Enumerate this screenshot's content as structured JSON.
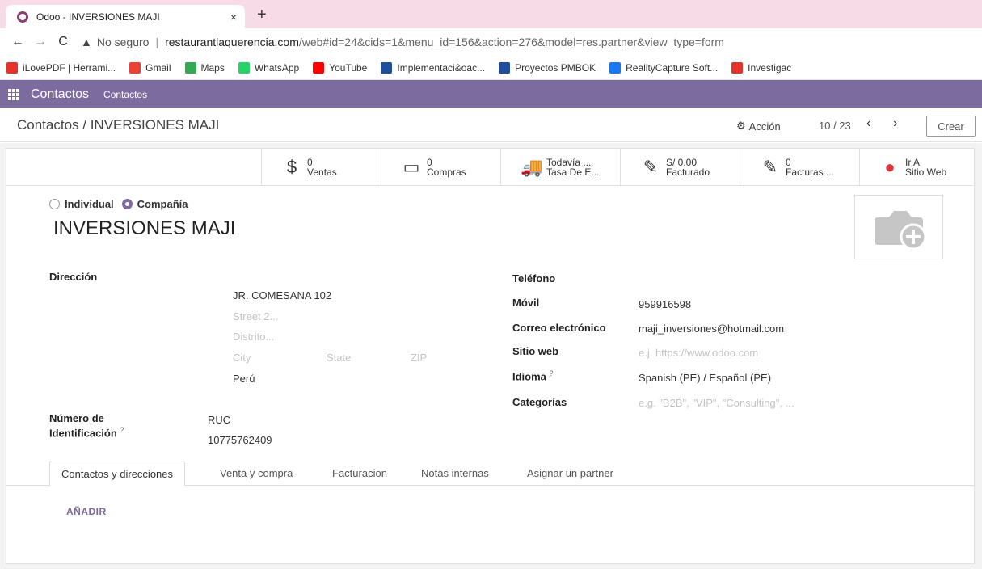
{
  "browser": {
    "tab_title": "Odoo - INVERSIONES MAJI",
    "tab_close": "×",
    "new_tab": "+",
    "not_secure": "No seguro",
    "url_host": "restaurantlaquerencia.com",
    "url_path": "/web#id=24&cids=1&menu_id=156&action=276&model=res.partner&view_type=form",
    "bookmarks": [
      {
        "label": "iLovePDF | Herrami...",
        "color": "#e5322d"
      },
      {
        "label": "Gmail",
        "color": "#ea4335"
      },
      {
        "label": "Maps",
        "color": "#34a853"
      },
      {
        "label": "WhatsApp",
        "color": "#25d366"
      },
      {
        "label": "YouTube",
        "color": "#ff0000"
      },
      {
        "label": "Implementaci&oac...",
        "color": "#1f4e9c"
      },
      {
        "label": "Proyectos PMBOK",
        "color": "#1f4e9c"
      },
      {
        "label": "RealityCapture Soft...",
        "color": "#1877f2"
      },
      {
        "label": "Investigac",
        "color": "#e5322d"
      }
    ]
  },
  "odoo": {
    "app_name": "Contactos",
    "menu_item": "Contactos",
    "brand_color": "#7c6b9f",
    "breadcrumb": "Contactos / INVERSIONES MAJI",
    "action_label": "Acción",
    "pager": "10 / 23",
    "create_label": "Crear"
  },
  "smart_buttons": [
    {
      "icon": "dollar-icon",
      "glyph": "$",
      "value": "0",
      "label": "Ventas"
    },
    {
      "icon": "credit-card-icon",
      "glyph": "▭",
      "value": "0",
      "label": "Compras"
    },
    {
      "icon": "truck-icon",
      "glyph": "🚚",
      "value": "Todavía ...",
      "label": "Tasa De E..."
    },
    {
      "icon": "edit-icon",
      "glyph": "✎",
      "value": "S/ 0.00",
      "label": "Facturado"
    },
    {
      "icon": "edit-icon",
      "glyph": "✎",
      "value": "0",
      "label": "Facturas ..."
    },
    {
      "icon": "globe-icon",
      "glyph": "●",
      "value": "Ir A",
      "label": "Sitio Web"
    }
  ],
  "form": {
    "type_individual": "Individual",
    "type_company": "Compañía",
    "name": "INVERSIONES MAJI",
    "address_label": "Dirección",
    "street": "JR. COMESANA 102",
    "street2_ph": "Street 2...",
    "district_ph": "Distrito...",
    "city_ph": "City",
    "state_ph": "State",
    "zip_ph": "ZIP",
    "country": "Perú",
    "id_label_1": "Número de",
    "id_label_2": "Identificación",
    "help_mark": "?",
    "id_type": "RUC",
    "id_number": "10775762409",
    "phone_label": "Teléfono",
    "mobile_label": "Móvil",
    "mobile": "959916598",
    "email_label": "Correo electrónico",
    "email": "maji_inversiones@hotmail.com",
    "website_label": "Sitio web",
    "website_ph": "e.j. https://www.odoo.com",
    "lang_label": "Idioma",
    "lang": "Spanish (PE) / Español (PE)",
    "tags_label": "Categorías",
    "tags_ph": "e.g. \"B2B\", \"VIP\", \"Consulting\", ..."
  },
  "notebook": {
    "tabs": [
      "Contactos y direcciones",
      "Venta y compra",
      "Facturacion",
      "Notas internas",
      "Asignar un partner"
    ],
    "add_label": "AÑADIR"
  }
}
